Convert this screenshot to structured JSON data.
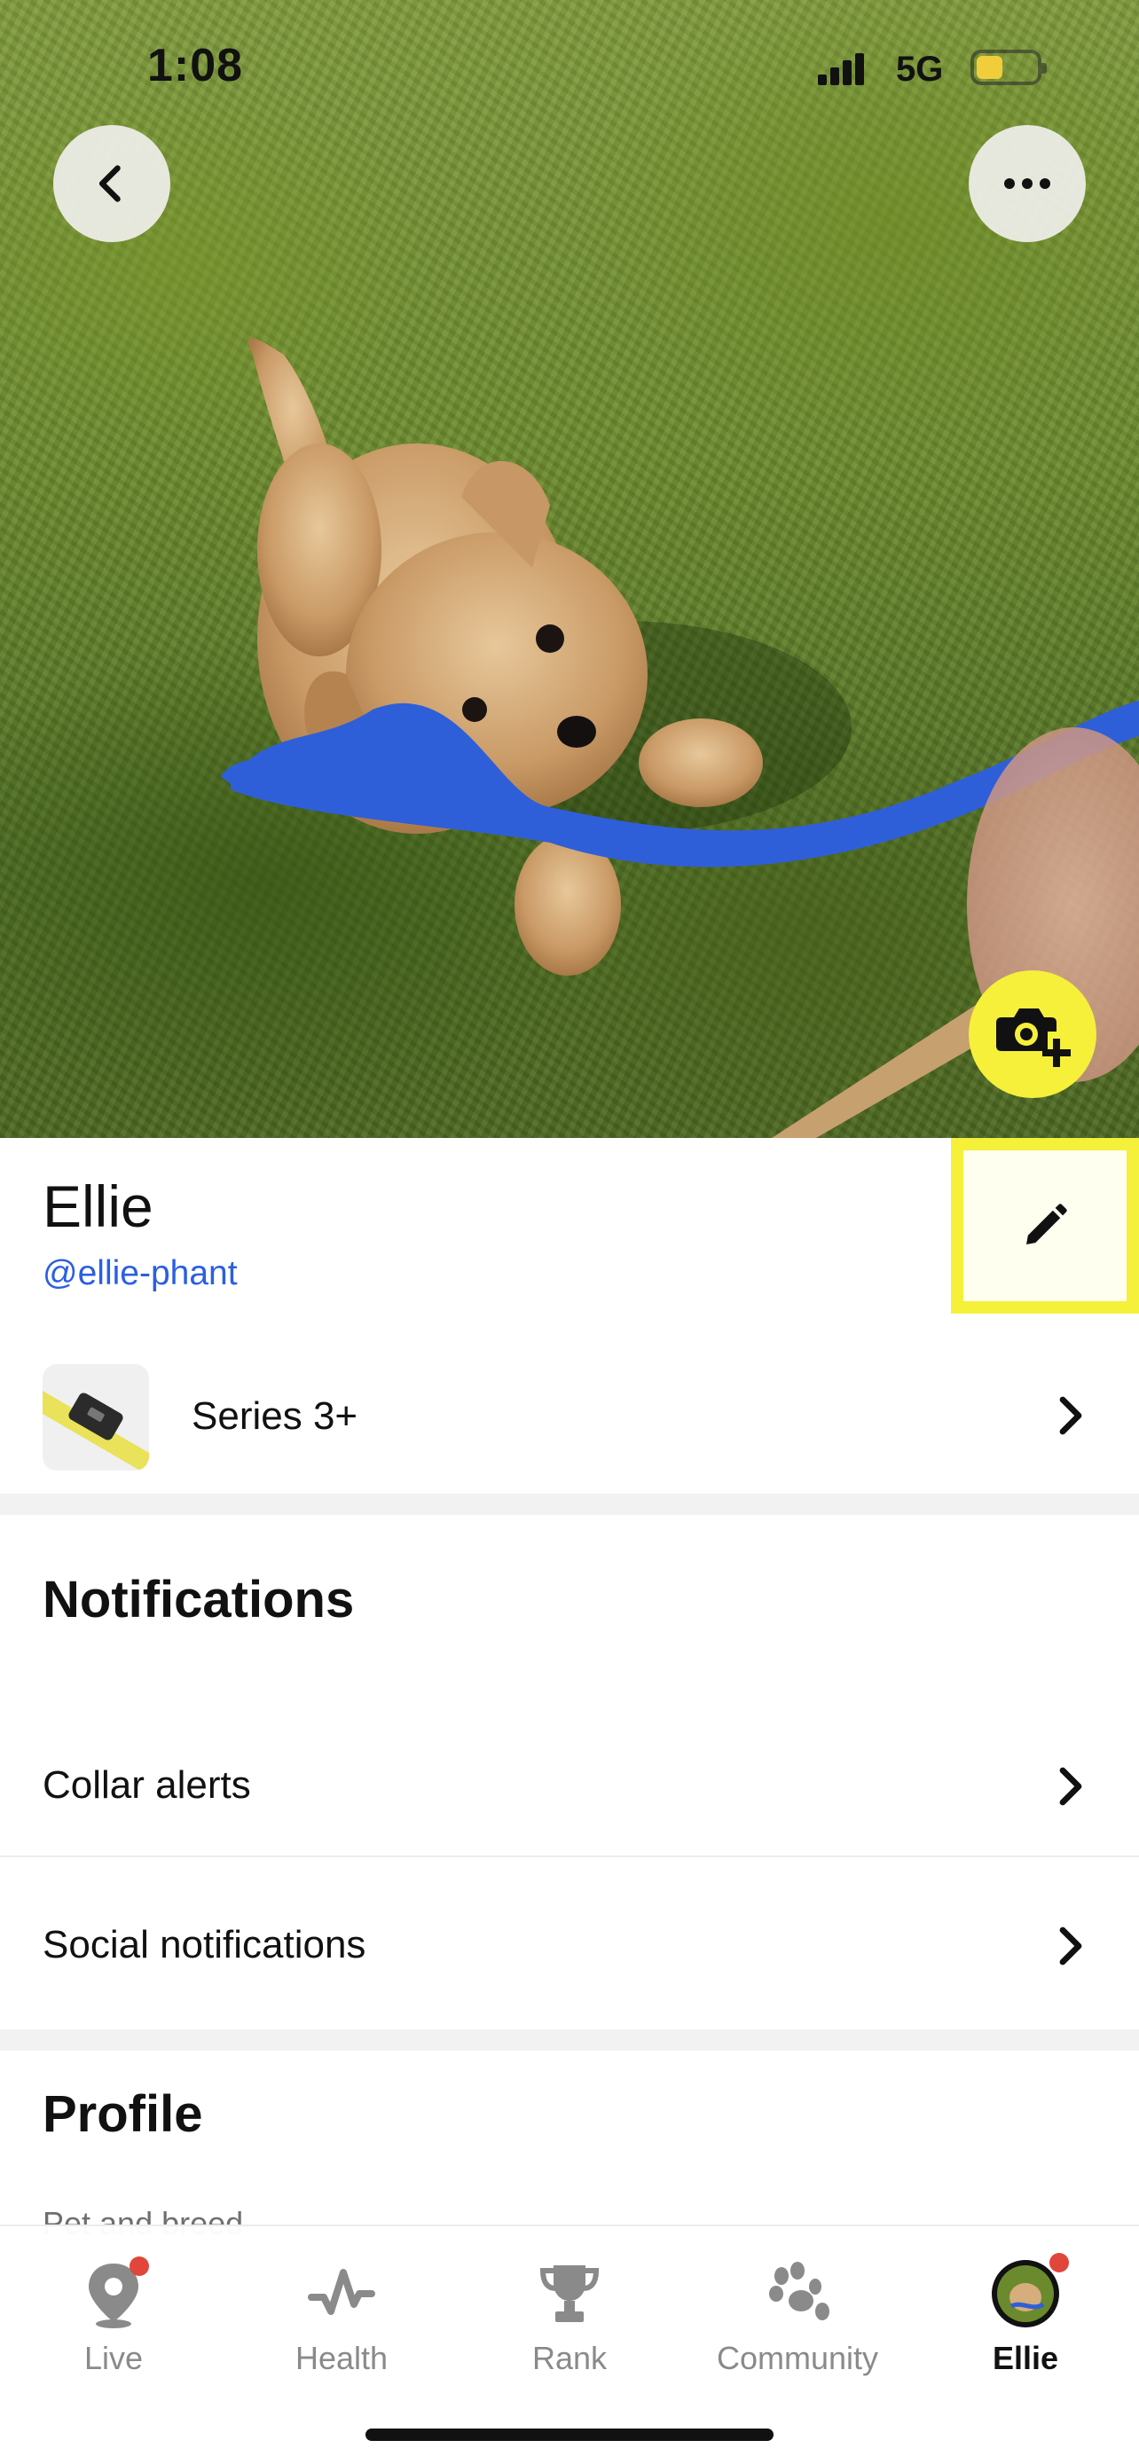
{
  "status_bar": {
    "time": "1:08",
    "network": "5G",
    "battery_level": 0.44
  },
  "profile": {
    "name": "Ellie",
    "handle": "@ellie-phant"
  },
  "device": {
    "label": "Series 3+"
  },
  "notifications": {
    "title": "Notifications",
    "items": [
      {
        "label": "Collar alerts"
      },
      {
        "label": "Social notifications"
      }
    ]
  },
  "profile_section": {
    "title": "Profile",
    "first_field_label": "Pet and breed"
  },
  "tabs": [
    {
      "label": "Live",
      "icon": "map-pin-icon",
      "badge": true
    },
    {
      "label": "Health",
      "icon": "pulse-icon",
      "badge": false
    },
    {
      "label": "Rank",
      "icon": "trophy-icon",
      "badge": false
    },
    {
      "label": "Community",
      "icon": "paw-icon",
      "badge": false
    },
    {
      "label": "Ellie",
      "icon": "pet-avatar",
      "badge": true,
      "active": true
    }
  ],
  "colors": {
    "accent_yellow": "#f5f03a",
    "link_blue": "#2a5fe0",
    "badge_red": "#e0463a"
  }
}
